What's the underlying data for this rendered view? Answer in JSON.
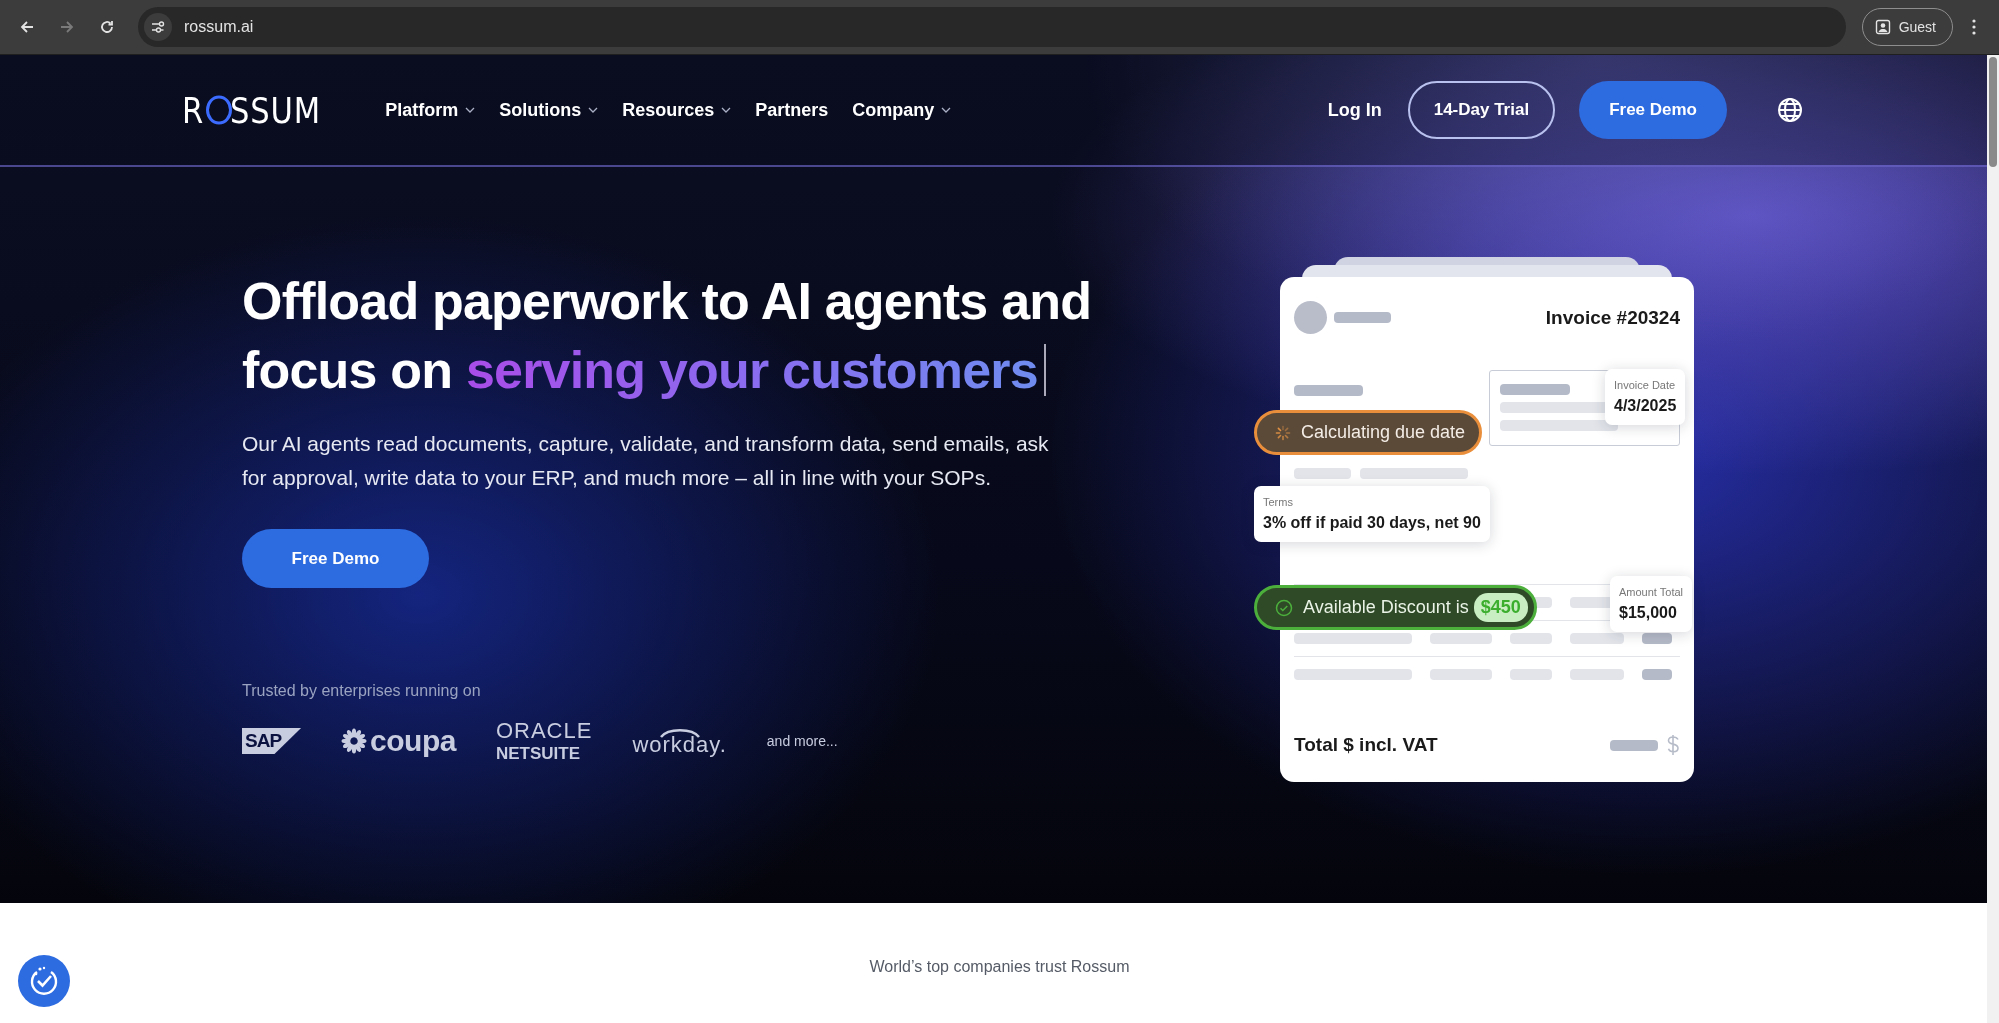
{
  "browser": {
    "back_enabled": true,
    "forward_enabled": false,
    "url": "rossum.ai",
    "profile": "Guest"
  },
  "nav": {
    "logo": {
      "before": "R",
      "after": "SSUM"
    },
    "items": [
      {
        "label": "Platform",
        "dropdown": true
      },
      {
        "label": "Solutions",
        "dropdown": true
      },
      {
        "label": "Resources",
        "dropdown": true
      },
      {
        "label": "Partners",
        "dropdown": false
      },
      {
        "label": "Company",
        "dropdown": true
      }
    ],
    "login": "Log In",
    "trial": "14-Day Trial",
    "demo": "Free Demo"
  },
  "hero": {
    "heading": {
      "text": "Offload paperwork to AI agents and focus on ",
      "highlight": "serving your customers"
    },
    "paragraph": "Our AI agents read documents, capture, validate, and transform data, send emails, ask for approval, write data to your ERP, and much more – all in line with your SOPs.",
    "cta": "Free Demo",
    "trusted_label": "Trusted by enterprises running on",
    "logos": [
      {
        "kind": "sap",
        "text": "SAP"
      },
      {
        "kind": "coupa",
        "text": "coupa"
      },
      {
        "kind": "oracle",
        "text": "ORACLE",
        "subtext": "NETSUITE"
      },
      {
        "kind": "workday",
        "text": "workday."
      }
    ],
    "more": "and more..."
  },
  "invoice": {
    "title": "Invoice #20324",
    "date_label": "Invoice Date",
    "date": "4/3/2025",
    "pills": [
      {
        "kind": "pending",
        "text": "Calculating due date"
      },
      {
        "kind": "done",
        "text": "Available Discount is",
        "amount": "$450"
      }
    ],
    "terms_label": "Terms",
    "terms": "3% off if paid 30 days, net 90",
    "amount_label": "Amount Total",
    "amount": "$15,000",
    "total_label": "Total $ incl. VAT"
  },
  "below": {
    "heading": "World’s top companies trust Rossum"
  }
}
